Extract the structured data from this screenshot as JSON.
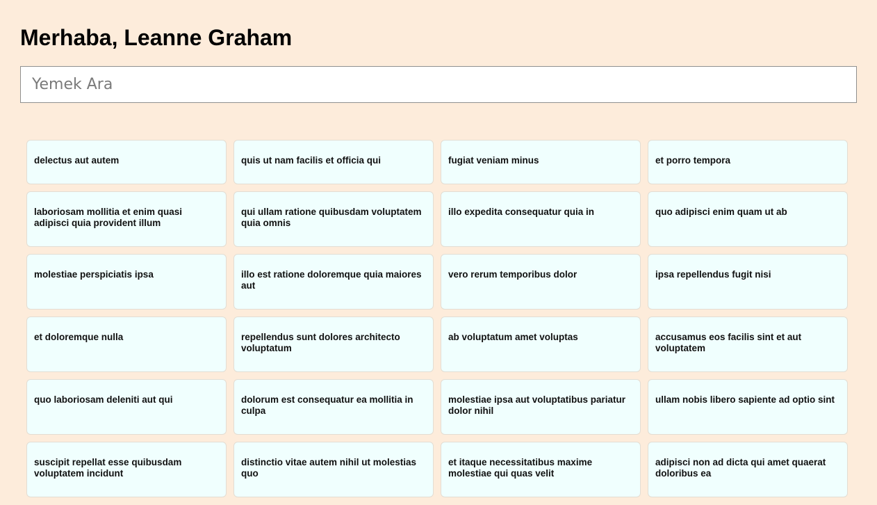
{
  "header": {
    "greeting": "Merhaba, Leanne Graham"
  },
  "search": {
    "placeholder": "Yemek Ara",
    "value": ""
  },
  "cards": [
    "delectus aut autem",
    "quis ut nam facilis et officia qui",
    "fugiat veniam minus",
    "et porro tempora",
    "laboriosam mollitia et enim quasi adipisci quia provident illum",
    "qui ullam ratione quibusdam voluptatem quia omnis",
    "illo expedita consequatur quia in",
    "quo adipisci enim quam ut ab",
    "molestiae perspiciatis ipsa",
    "illo est ratione doloremque quia maiores aut",
    "vero rerum temporibus dolor",
    "ipsa repellendus fugit nisi",
    "et doloremque nulla",
    "repellendus sunt dolores architecto voluptatum",
    "ab voluptatum amet voluptas",
    "accusamus eos facilis sint et aut voluptatem",
    "quo laboriosam deleniti aut qui",
    "dolorum est consequatur ea mollitia in culpa",
    "molestiae ipsa aut voluptatibus pariatur dolor nihil",
    "ullam nobis libero sapiente ad optio sint",
    "suscipit repellat esse quibusdam voluptatem incidunt",
    "distinctio vitae autem nihil ut molestias quo",
    "et itaque necessitatibus maxime molestiae qui quas velit",
    "adipisci non ad dicta qui amet quaerat doloribus ea"
  ],
  "colors": {
    "page_background": "#fdecdb",
    "card_background": "#f0fffe"
  }
}
